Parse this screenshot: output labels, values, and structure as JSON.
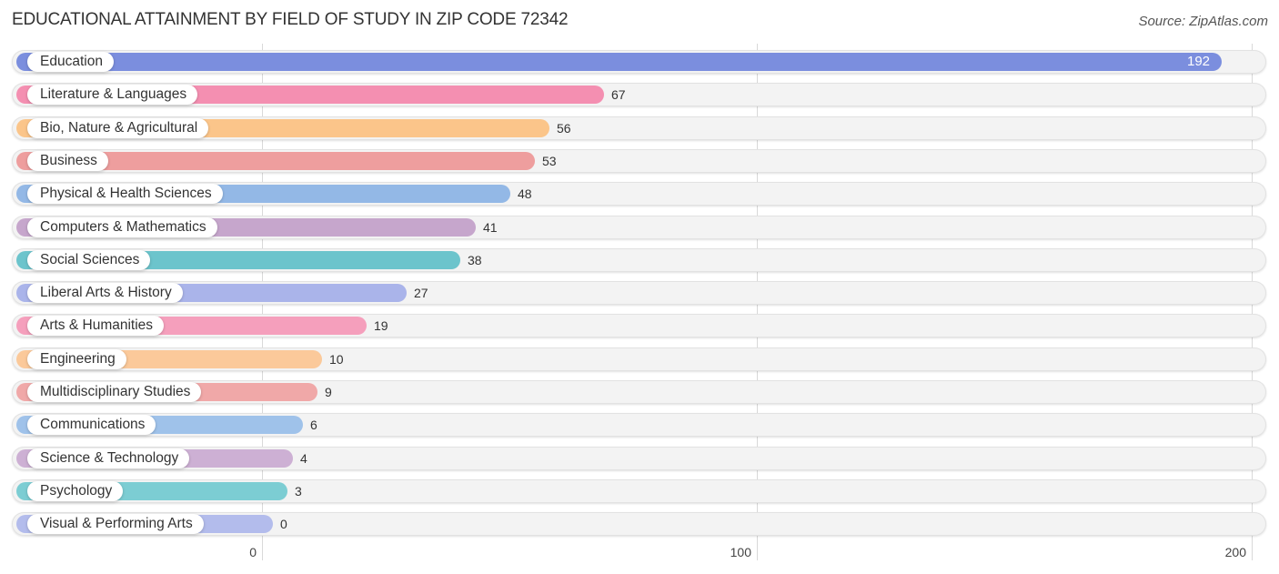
{
  "chart_data": {
    "type": "bar",
    "orientation": "horizontal",
    "title": "EDUCATIONAL ATTAINMENT BY FIELD OF STUDY IN ZIP CODE 72342",
    "source": "Source: ZipAtlas.com",
    "xlabel": "",
    "ylabel": "",
    "xlim": [
      0,
      200
    ],
    "xticks": [
      0,
      100,
      200
    ],
    "xtick_labels": [
      "0",
      "100",
      "200"
    ],
    "grid": true,
    "categories": [
      "Education",
      "Literature & Languages",
      "Bio, Nature & Agricultural",
      "Business",
      "Physical & Health Sciences",
      "Computers & Mathematics",
      "Social Sciences",
      "Liberal Arts & History",
      "Arts & Humanities",
      "Engineering",
      "Multidisciplinary Studies",
      "Communications",
      "Science & Technology",
      "Psychology",
      "Visual & Performing Arts"
    ],
    "values": [
      192,
      67,
      56,
      53,
      48,
      41,
      38,
      27,
      19,
      10,
      9,
      6,
      4,
      3,
      0
    ],
    "value_labels": [
      "192",
      "67",
      "56",
      "53",
      "48",
      "41",
      "38",
      "27",
      "19",
      "10",
      "9",
      "6",
      "4",
      "3",
      "0"
    ],
    "colors": [
      "#7b8ede",
      "#f48fb1",
      "#fbc58a",
      "#ee9e9e",
      "#93b8e6",
      "#c6a6cc",
      "#6cc4cc",
      "#aab4ea",
      "#f59fbc",
      "#fbc99a",
      "#f0a8a8",
      "#9fc2ea",
      "#cdb0d4",
      "#7ccdd3",
      "#b3bcec"
    ]
  }
}
